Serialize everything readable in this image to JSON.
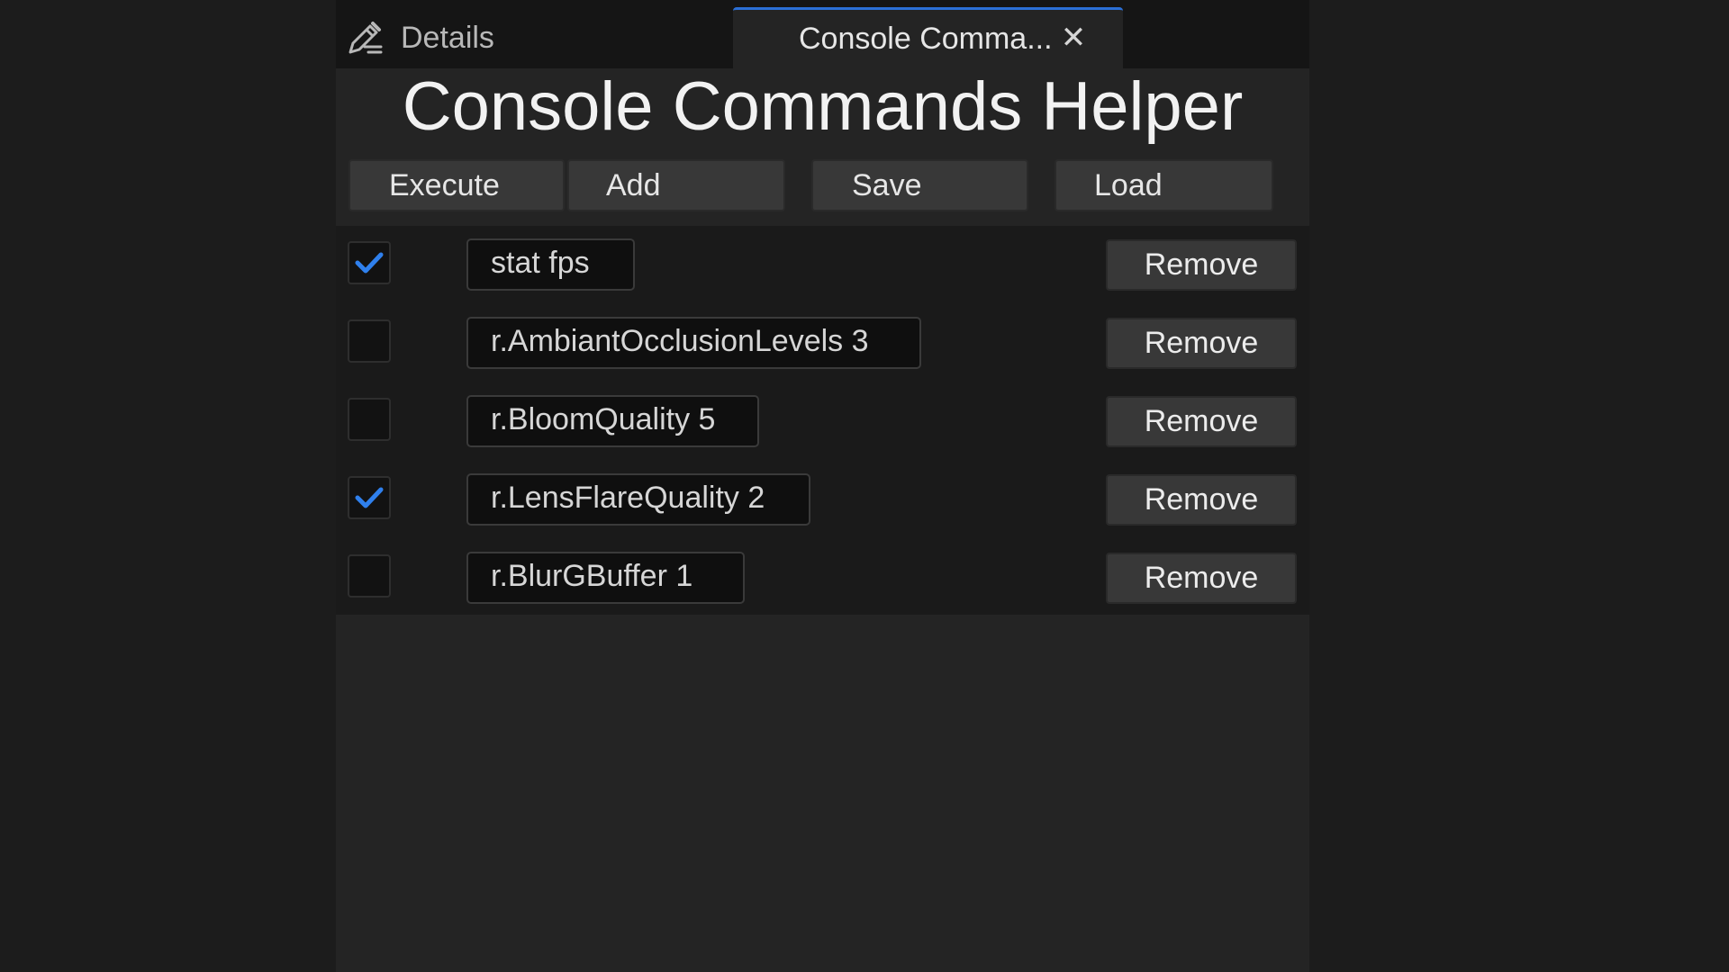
{
  "tabs": {
    "details": {
      "label": "Details",
      "icon": "edit-pencil-icon"
    },
    "console": {
      "label": "Console Comma...",
      "close_icon": "close-icon",
      "close_glyph": "✕"
    }
  },
  "title": "Console Commands Helper",
  "toolbar": {
    "execute_label": "Execute",
    "add_label": "Add",
    "save_label": "Save",
    "load_label": "Load"
  },
  "commands": [
    {
      "command": "stat fps",
      "checked": true,
      "remove_label": "Remove"
    },
    {
      "command": "r.AmbiantOcclusionLevels 3",
      "checked": false,
      "remove_label": "Remove"
    },
    {
      "command": "r.BloomQuality 5",
      "checked": false,
      "remove_label": "Remove"
    },
    {
      "command": "r.LensFlareQuality 2",
      "checked": true,
      "remove_label": "Remove"
    },
    {
      "command": "r.BlurGBuffer 1",
      "checked": false,
      "remove_label": "Remove"
    }
  ],
  "colors": {
    "accent": "#2b6fd6",
    "check": "#2f80ed",
    "panel_bg": "#242424",
    "list_bg": "#1a1a1a"
  }
}
